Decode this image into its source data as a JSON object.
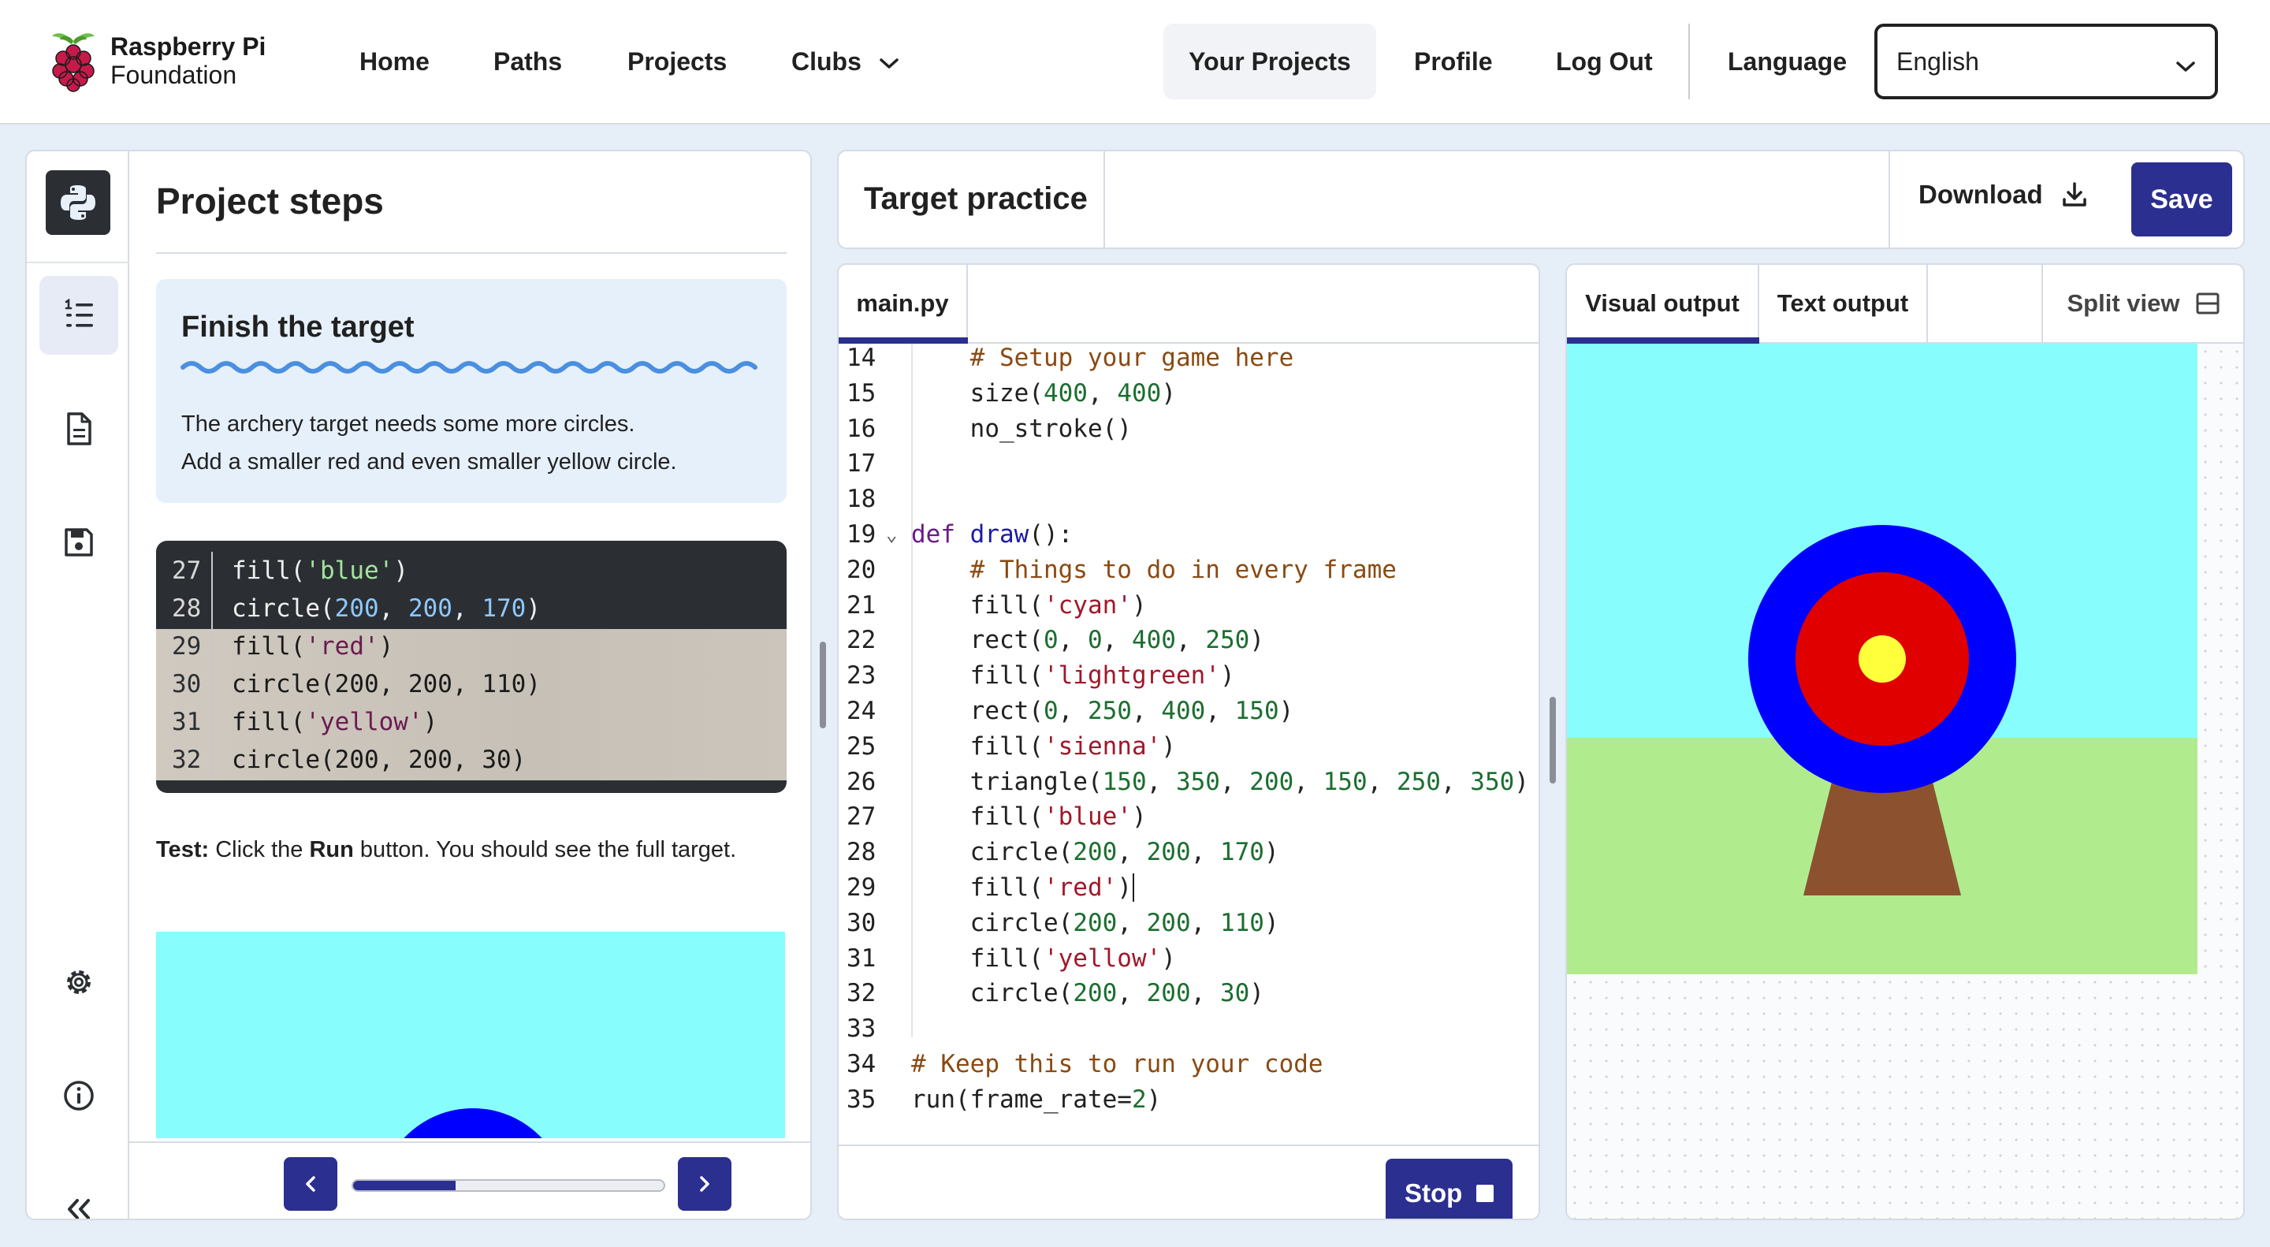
{
  "header": {
    "logo_line1": "Raspberry Pi",
    "logo_line2": "Foundation",
    "nav": [
      "Home",
      "Paths",
      "Projects",
      "Clubs"
    ],
    "your_projects": "Your Projects",
    "profile": "Profile",
    "logout": "Log Out",
    "language_label": "Language",
    "language_value": "English"
  },
  "steps": {
    "title": "Project steps",
    "task_title": "Finish the target",
    "task_line1": "The archery target needs some more circles.",
    "task_line2": "Add a smaller red and even smaller yellow circle.",
    "snippet": [
      {
        "num": "27",
        "pre": "fill(",
        "str": "'blue'",
        "post": ")"
      },
      {
        "num": "28",
        "pre": "circle(",
        "nums": [
          "200",
          "200",
          "170"
        ],
        "post": ")"
      },
      {
        "num": "29",
        "pre": "fill(",
        "str": "'red'",
        "post": ")"
      },
      {
        "num": "30",
        "pre": "circle(",
        "nums": [
          "200",
          "200",
          "110"
        ],
        "post": ")"
      },
      {
        "num": "31",
        "pre": "fill(",
        "str": "'yellow'",
        "post": ")"
      },
      {
        "num": "32",
        "pre": "circle(",
        "nums": [
          "200",
          "200",
          "30"
        ],
        "post": ")"
      }
    ],
    "test_bold": "Test:",
    "test_text1": " Click the ",
    "test_run": "Run",
    "test_text2": " button. You should see the full target.",
    "progress_fraction": 0.33
  },
  "project": {
    "name": "Target practice",
    "download": "Download",
    "save": "Save"
  },
  "editor": {
    "tab": "main.py",
    "lines": [
      {
        "n": "14",
        "html": "    <span class=\"c-com\"># Setup your game here</span>"
      },
      {
        "n": "15",
        "html": "    size(<span class=\"c-num\">400</span>, <span class=\"c-num\">400</span>)"
      },
      {
        "n": "16",
        "html": "    no_stroke()"
      },
      {
        "n": "17",
        "html": ""
      },
      {
        "n": "18",
        "html": ""
      },
      {
        "n": "19",
        "html": "<span class=\"c-kw\">def</span> <span class=\"c-fn\">draw</span>():",
        "fold": true
      },
      {
        "n": "20",
        "html": "    <span class=\"c-com\"># Things to do in every frame</span>"
      },
      {
        "n": "21",
        "html": "    fill(<span class=\"c-str\">'cyan'</span>)"
      },
      {
        "n": "22",
        "html": "    rect(<span class=\"c-num\">0</span>, <span class=\"c-num\">0</span>, <span class=\"c-num\">400</span>, <span class=\"c-num\">250</span>)"
      },
      {
        "n": "23",
        "html": "    fill(<span class=\"c-str\">'lightgreen'</span>)"
      },
      {
        "n": "24",
        "html": "    rect(<span class=\"c-num\">0</span>, <span class=\"c-num\">250</span>, <span class=\"c-num\">400</span>, <span class=\"c-num\">150</span>)"
      },
      {
        "n": "25",
        "html": "    fill(<span class=\"c-str\">'sienna'</span>)"
      },
      {
        "n": "26",
        "html": "    triangle(<span class=\"c-num\">150</span>, <span class=\"c-num\">350</span>, <span class=\"c-num\">200</span>, <span class=\"c-num\">150</span>, <span class=\"c-num\">250</span>, <span class=\"c-num\">350</span>)"
      },
      {
        "n": "27",
        "html": "    fill(<span class=\"c-str\">'blue'</span>)"
      },
      {
        "n": "28",
        "html": "    circle(<span class=\"c-num\">200</span>, <span class=\"c-num\">200</span>, <span class=\"c-num\">170</span>)"
      },
      {
        "n": "29",
        "html": "    fill(<span class=\"c-str\">'red'</span>)"
      },
      {
        "n": "30",
        "html": "    circle(<span class=\"c-num\">200</span>, <span class=\"c-num\">200</span>, <span class=\"c-num\">110</span>)"
      },
      {
        "n": "31",
        "html": "    fill(<span class=\"c-str\">'yellow'</span>)"
      },
      {
        "n": "32",
        "html": "    circle(<span class=\"c-num\">200</span>, <span class=\"c-num\">200</span>, <span class=\"c-num\">30</span>)"
      },
      {
        "n": "33",
        "html": ""
      },
      {
        "n": "34",
        "html": "<span class=\"c-com\"># Keep this to run your code</span>"
      },
      {
        "n": "35",
        "html": "run(frame_rate=<span class=\"c-num\">2</span>)"
      }
    ],
    "stop": "Stop"
  },
  "output": {
    "visual_tab": "Visual output",
    "text_tab": "Text output",
    "split_view": "Split view"
  },
  "colors": {
    "brand": "#2b2f8f",
    "sky": "#88fdfd",
    "grass": "#b0ec8e",
    "trunk": "#8c5230",
    "blue": "#0000ff",
    "red": "#e00000",
    "yellow": "#ffff3c"
  }
}
